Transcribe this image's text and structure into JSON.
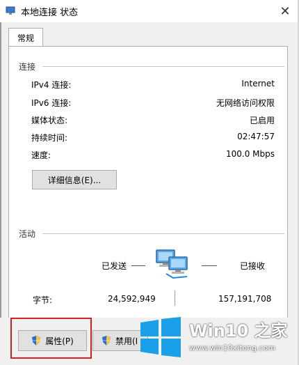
{
  "window": {
    "title": "本地连接 状态",
    "close_glyph": "✕"
  },
  "tabs": [
    {
      "label": "常规"
    }
  ],
  "connection": {
    "header": "连接",
    "rows": [
      {
        "label": "IPv4 连接:",
        "value": "Internet"
      },
      {
        "label": "IPv6 连接:",
        "value": "无网络访问权限"
      },
      {
        "label": "媒体状态:",
        "value": "已启用"
      },
      {
        "label": "持续时间:",
        "value": "02:47:57"
      },
      {
        "label": "速度:",
        "value": "100.0 Mbps"
      }
    ],
    "details_button": "详细信息(E)..."
  },
  "activity": {
    "header": "活动",
    "sent_label": "已发送",
    "received_label": "已接收",
    "bytes_label": "字节:",
    "bytes_sent": "24,592,949",
    "bytes_received": "157,191,708"
  },
  "footer": {
    "properties_button": "属性(P)",
    "disable_button": "禁用(I"
  },
  "watermark": {
    "title": "Win10 之家",
    "url": "www.win10xitong.com"
  },
  "colors": {
    "highlight_box": "#d81f1f",
    "win_logo": "#1aa0e8",
    "shield_blue": "#2a6fd0",
    "shield_yellow": "#f2c14e"
  }
}
